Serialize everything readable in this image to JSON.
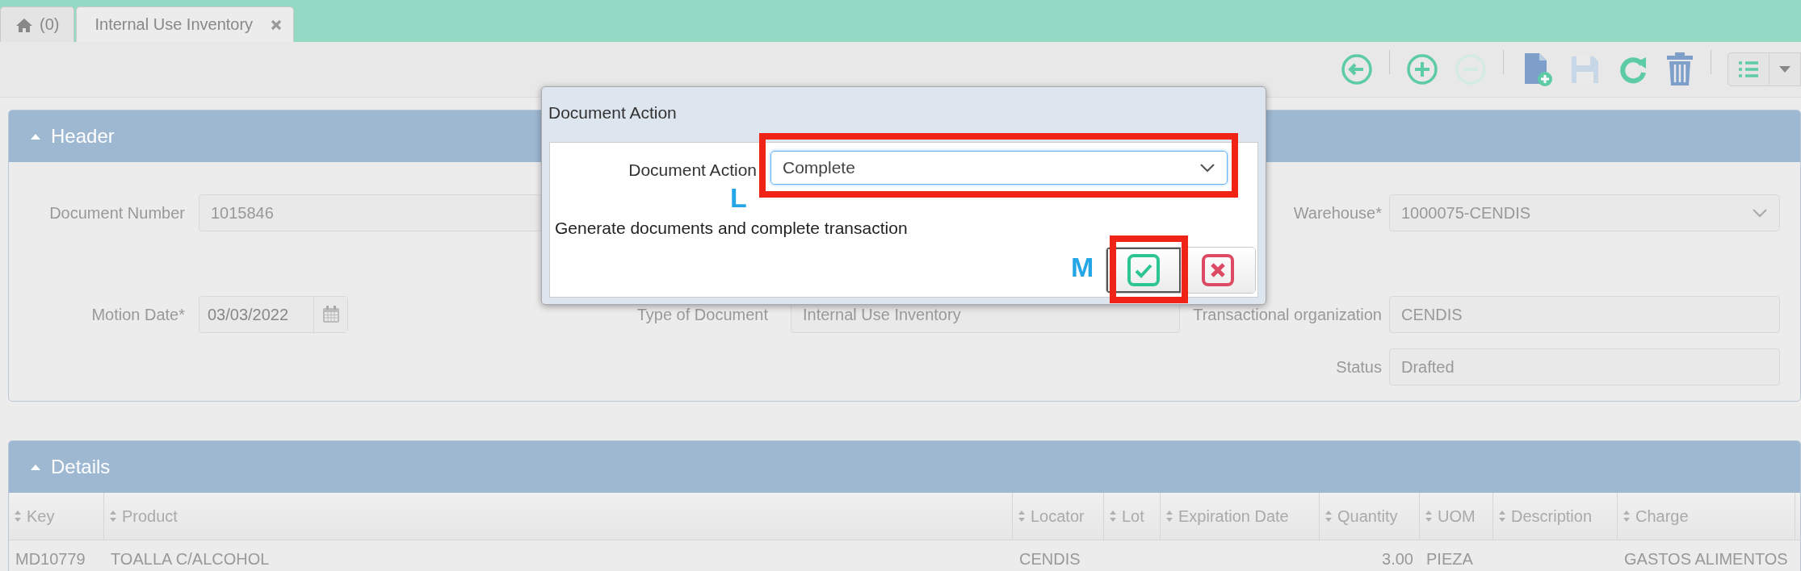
{
  "tabs": [
    {
      "kind": "home",
      "label": "(0)",
      "selected": false
    },
    {
      "kind": "document",
      "label": "Internal Use Inventory",
      "selected": true
    }
  ],
  "toolbar": {
    "buttons": [
      {
        "kind": "back",
        "disabled": false
      },
      {
        "kind": "add",
        "disabled": false
      },
      {
        "kind": "remove",
        "disabled": true
      },
      {
        "kind": "new-document",
        "disabled": false
      },
      {
        "kind": "save",
        "disabled": true
      },
      {
        "kind": "refresh",
        "disabled": false
      },
      {
        "kind": "delete",
        "disabled": false
      }
    ]
  },
  "header": {
    "title": "Header",
    "expanded": true,
    "rows": [
      {
        "left": {
          "kind": "text",
          "label": "Document Number",
          "value": "1015846"
        },
        "right": {
          "kind": "select",
          "label": "Warehouse*",
          "value": "1000075-CENDIS"
        }
      },
      {
        "left": {
          "kind": "date",
          "label": "Motion Date*",
          "value": "03/03/2022"
        },
        "middle": {
          "kind": "text",
          "label": "Type of Document",
          "value": "Internal Use Inventory"
        },
        "right": {
          "kind": "text",
          "label": "Transactional organization",
          "value": "CENDIS"
        }
      },
      {
        "right": {
          "kind": "text",
          "label": "Status",
          "value": "Drafted"
        }
      }
    ]
  },
  "details": {
    "title": "Details",
    "expanded": true,
    "columns": [
      {
        "label": "Key"
      },
      {
        "label": "Product"
      },
      {
        "label": "Locator"
      },
      {
        "label": "Lot"
      },
      {
        "label": "Expiration Date"
      },
      {
        "label": "Quantity"
      },
      {
        "label": "UOM"
      },
      {
        "label": "Description"
      },
      {
        "label": "Charge"
      }
    ],
    "rows": [
      {
        "cells": [
          "MD10779",
          "TOALLA C/ALCOHOL",
          "CENDIS",
          "",
          "",
          "3.00",
          "PIEZA",
          "",
          "GASTOS ALIMENTOS"
        ]
      }
    ]
  },
  "dialog": {
    "title": "Document Action",
    "field_label": "Document Action",
    "value": "Complete",
    "description": "Generate documents and complete transaction",
    "buttons": [
      {
        "kind": "ok",
        "focused": true
      },
      {
        "kind": "cancel",
        "focused": false
      }
    ],
    "field_callout": "L",
    "button_callout": "M"
  }
}
